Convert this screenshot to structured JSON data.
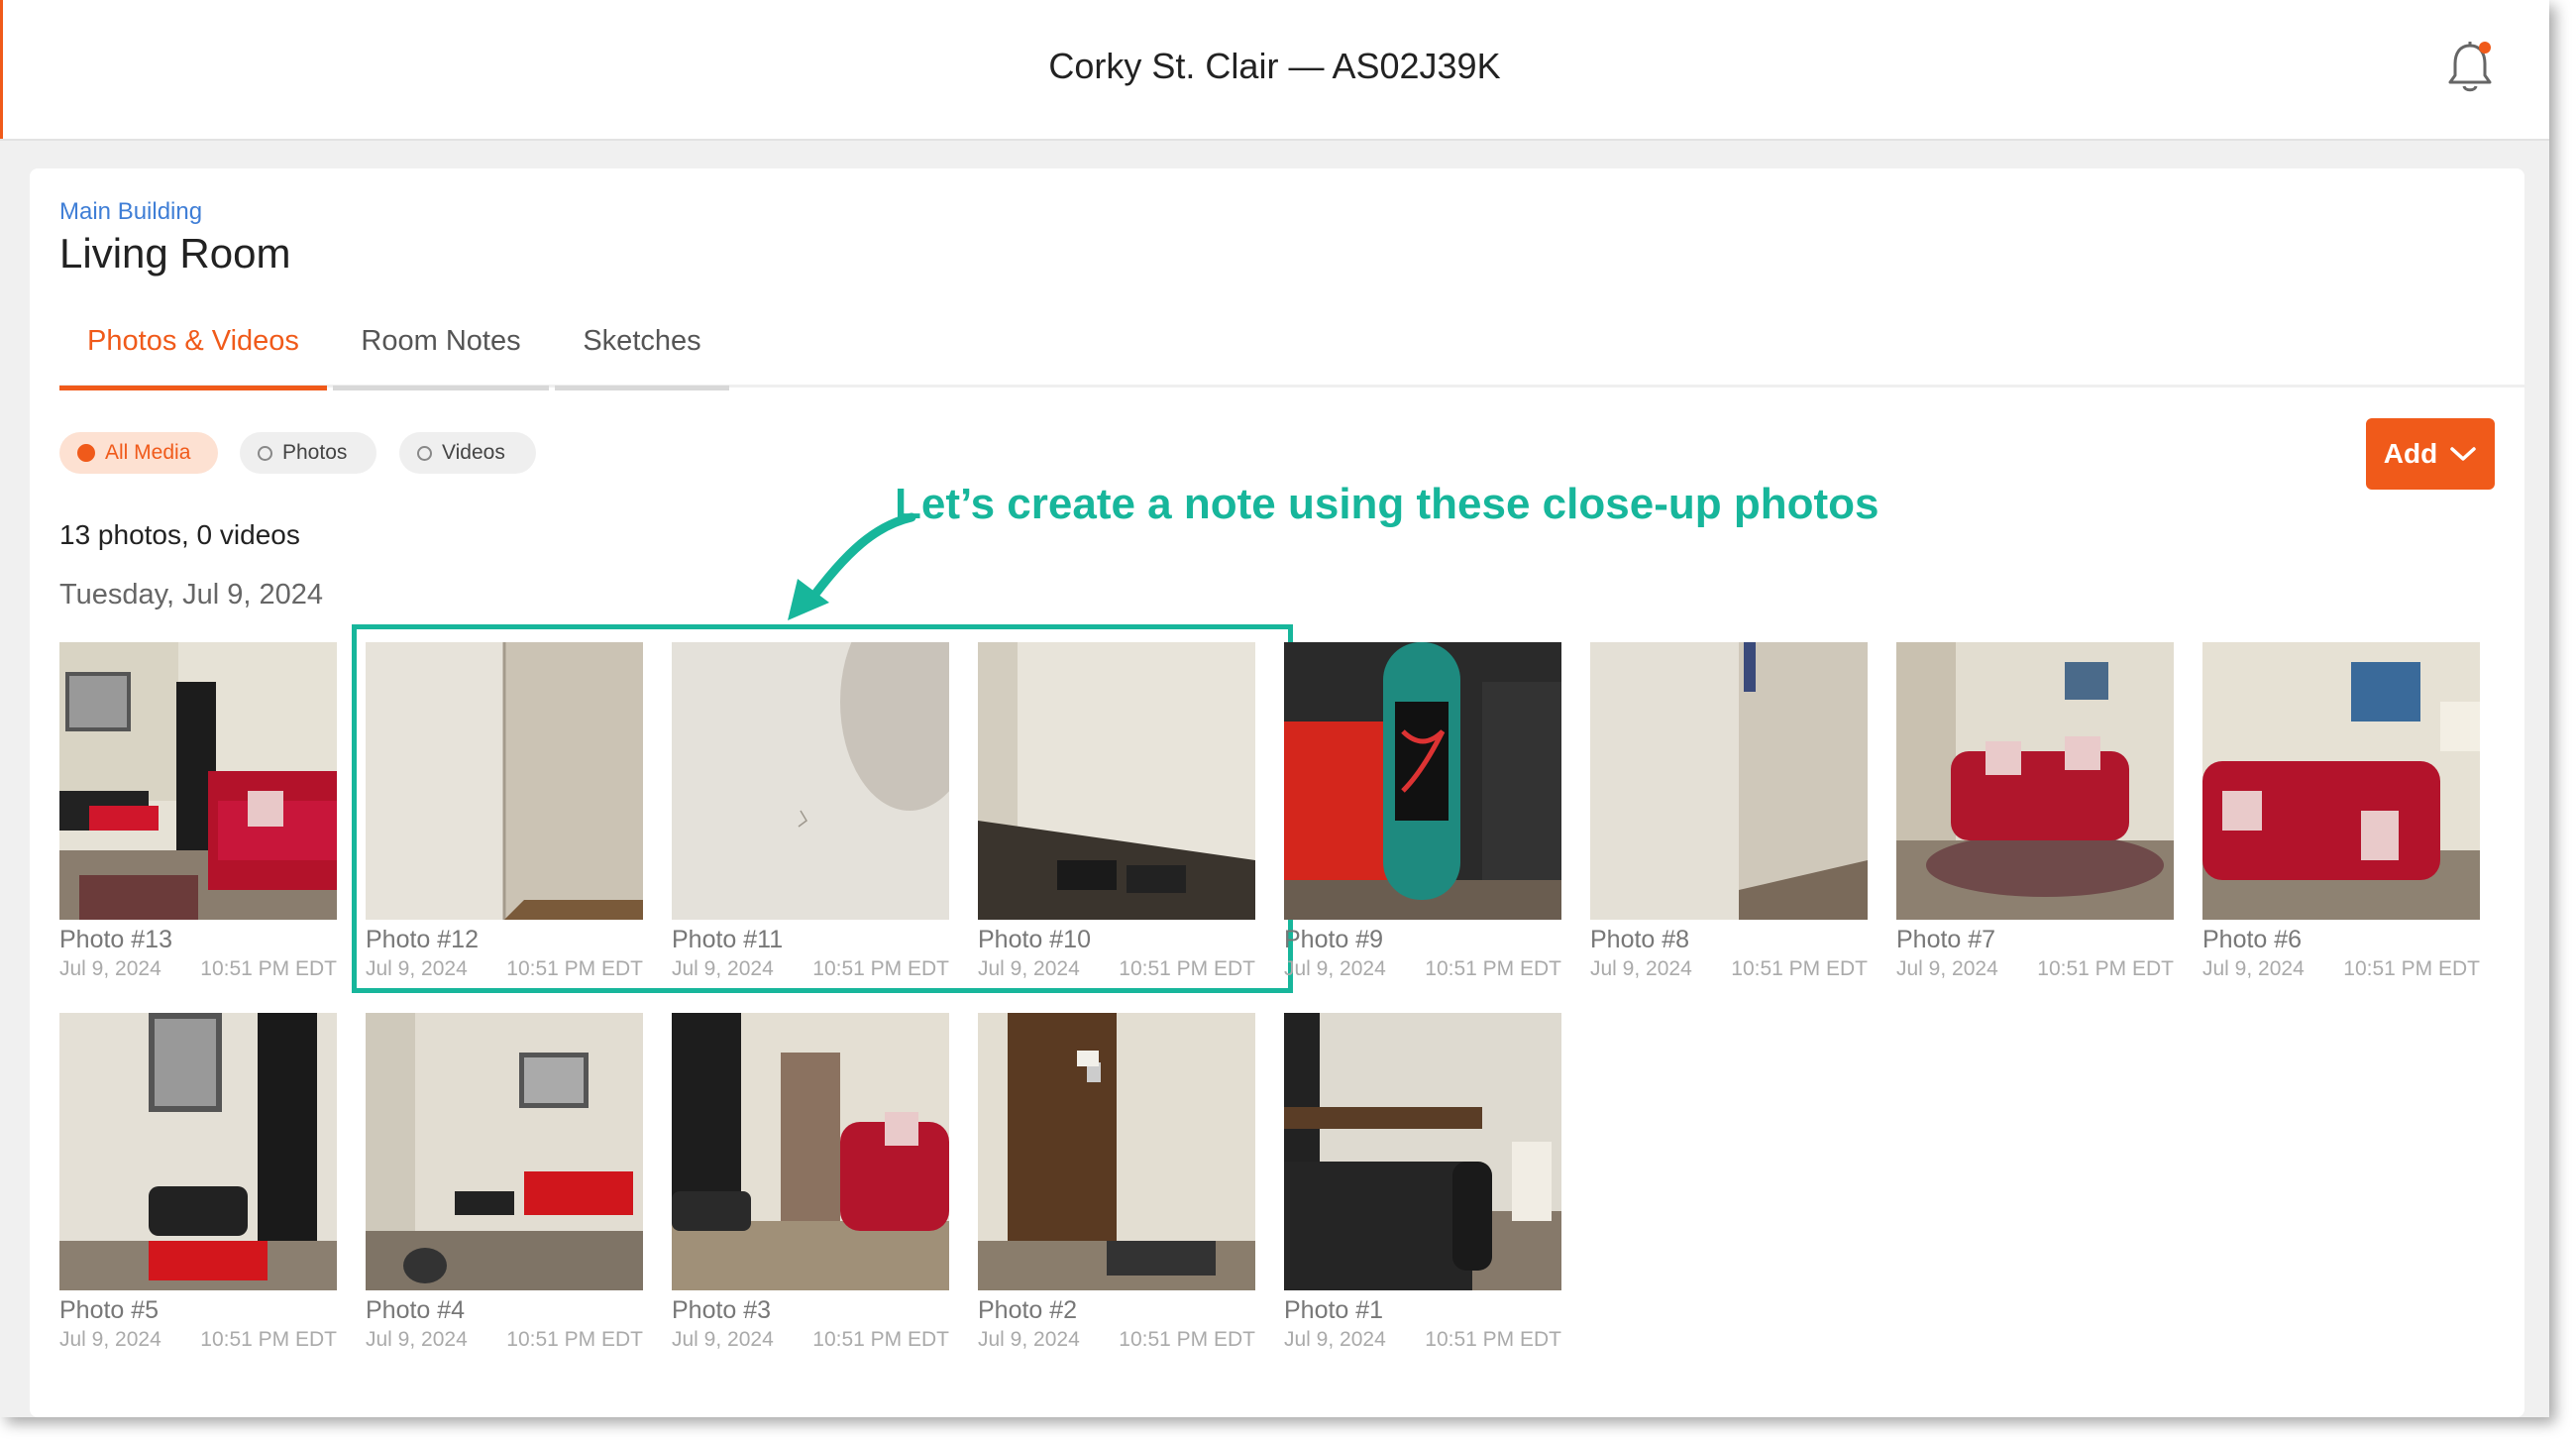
{
  "header": {
    "title": "Corky St. Clair — AS02J39K",
    "notification_icon": "bell-icon",
    "accent": "#f05a1a"
  },
  "room": {
    "breadcrumb": "Main Building",
    "title": "Living Room"
  },
  "tabs": [
    {
      "label": "Photos & Videos",
      "active": true
    },
    {
      "label": "Room Notes",
      "active": false
    },
    {
      "label": "Sketches",
      "active": false
    }
  ],
  "filters": [
    {
      "label": "All Media",
      "selected": true
    },
    {
      "label": "Photos",
      "selected": false
    },
    {
      "label": "Videos",
      "selected": false
    }
  ],
  "add_button": {
    "label": "Add"
  },
  "summary": "13 photos, 0 videos",
  "date_group": "Tuesday, Jul 9, 2024",
  "annotation": {
    "text": "Let’s create a note using these close-up photos",
    "color": "#17b69b"
  },
  "photos": [
    {
      "title": "Photo #13",
      "date": "Jul 9, 2024",
      "time": "10:51 PM EDT",
      "highlighted": false
    },
    {
      "title": "Photo #12",
      "date": "Jul 9, 2024",
      "time": "10:51 PM EDT",
      "highlighted": true
    },
    {
      "title": "Photo #11",
      "date": "Jul 9, 2024",
      "time": "10:51 PM EDT",
      "highlighted": true
    },
    {
      "title": "Photo #10",
      "date": "Jul 9, 2024",
      "time": "10:51 PM EDT",
      "highlighted": true
    },
    {
      "title": "Photo #9",
      "date": "Jul 9, 2024",
      "time": "10:51 PM EDT",
      "highlighted": false
    },
    {
      "title": "Photo #8",
      "date": "Jul 9, 2024",
      "time": "10:51 PM EDT",
      "highlighted": false
    },
    {
      "title": "Photo #7",
      "date": "Jul 9, 2024",
      "time": "10:51 PM EDT",
      "highlighted": false
    },
    {
      "title": "Photo #6",
      "date": "Jul 9, 2024",
      "time": "10:51 PM EDT",
      "highlighted": false
    },
    {
      "title": "Photo #5",
      "date": "Jul 9, 2024",
      "time": "10:51 PM EDT",
      "highlighted": false
    },
    {
      "title": "Photo #4",
      "date": "Jul 9, 2024",
      "time": "10:51 PM EDT",
      "highlighted": false
    },
    {
      "title": "Photo #3",
      "date": "Jul 9, 2024",
      "time": "10:51 PM EDT",
      "highlighted": false
    },
    {
      "title": "Photo #2",
      "date": "Jul 9, 2024",
      "time": "10:51 PM EDT",
      "highlighted": false
    },
    {
      "title": "Photo #1",
      "date": "Jul 9, 2024",
      "time": "10:51 PM EDT",
      "highlighted": false
    }
  ]
}
